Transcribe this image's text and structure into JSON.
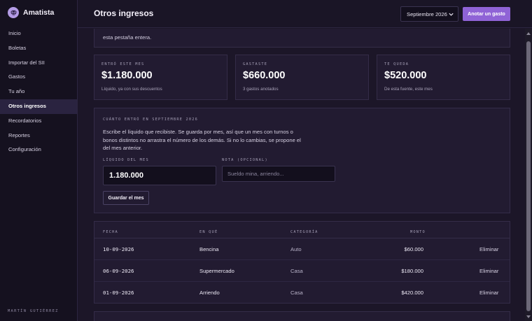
{
  "app": {
    "name": "Amatista"
  },
  "sidebar": {
    "items": [
      {
        "label": "Inicio",
        "active": false
      },
      {
        "label": "Boletas",
        "active": false
      },
      {
        "label": "Importar del SII",
        "active": false
      },
      {
        "label": "Gastos",
        "active": false
      },
      {
        "label": "Tu año",
        "active": false
      },
      {
        "label": "Otros ingresos",
        "active": true
      },
      {
        "label": "Recordatorios",
        "active": false
      },
      {
        "label": "Reportes",
        "active": false
      },
      {
        "label": "Configuración",
        "active": false
      }
    ],
    "user": "MARTÍN GUTIÉRREZ"
  },
  "header": {
    "title": "Otros ingresos",
    "month_selected": "Septiembre 2026",
    "add_expense_label": "Anotar un gasto"
  },
  "intro": {
    "text": "esta pestaña entera."
  },
  "stats": [
    {
      "label": "ENTRÓ ESTE MES",
      "value": "$1.180.000",
      "sub": "Líquido, ya con sus descuentos"
    },
    {
      "label": "GASTASTE",
      "value": "$660.000",
      "sub": "3 gastos anotados"
    },
    {
      "label": "TE QUEDA",
      "value": "$520.000",
      "sub": "De esta fuente, este mes"
    }
  ],
  "income_form": {
    "title": "CUÁNTO ENTRÓ EN SEPTIEMBRE 2026",
    "description": "Escribe el líquido que recibiste. Se guarda por mes, así que un mes con turnos o bonos distintos no arrastra el número de los demás. Si no lo cambias, se propone el del mes anterior.",
    "amount_label": "LÍQUIDO DEL MES",
    "amount_value": "1.180.000",
    "note_label": "NOTA (OPCIONAL)",
    "note_placeholder": "Sueldo mina, arriendo...",
    "save_label": "Guardar el mes"
  },
  "table": {
    "headers": {
      "date": "FECHA",
      "desc": "EN QUÉ",
      "category": "CATEGORÍA",
      "amount": "MONTO"
    },
    "rows": [
      {
        "date": "10-09-2026",
        "desc": "Bencina",
        "category": "Auto",
        "amount": "$60.000",
        "action": "Eliminar"
      },
      {
        "date": "06-09-2026",
        "desc": "Supermercado",
        "category": "Casa",
        "amount": "$180.000",
        "action": "Eliminar"
      },
      {
        "date": "01-09-2026",
        "desc": "Arriendo",
        "category": "Casa",
        "amount": "$420.000",
        "action": "Eliminar"
      }
    ]
  }
}
